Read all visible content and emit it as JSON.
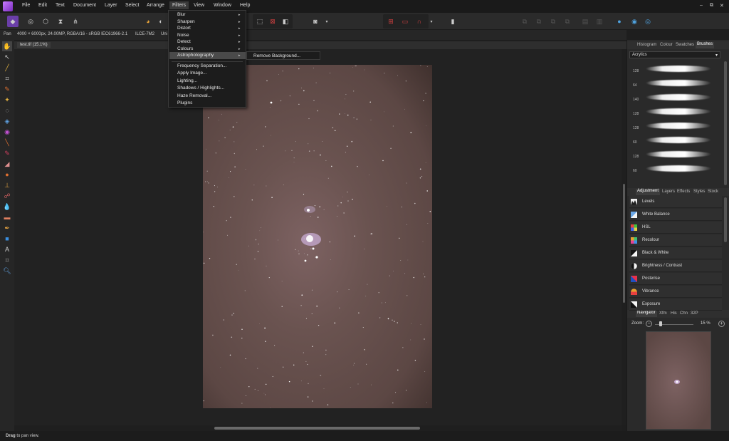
{
  "menubar": {
    "items": [
      "File",
      "Edit",
      "Text",
      "Document",
      "Layer",
      "Select",
      "Arrange",
      "Filters",
      "View",
      "Window",
      "Help"
    ],
    "active": "Filters",
    "window_controls": [
      "–",
      "⧉",
      "✕"
    ]
  },
  "contextbar": {
    "tool": "Pan",
    "info": "4000 × 6000px, 24.00MP, RGBA/16 - sRGB IEC61966-2.1",
    "camera": "ILCE-7M2",
    "units": "Uni"
  },
  "document": {
    "tab": "test.tif (15.1%)"
  },
  "filters_menu": {
    "items": [
      "Blur",
      "Sharpen",
      "Distort",
      "Noise",
      "Detect",
      "Colours",
      "Astrophotography",
      "Frequency Separation...",
      "Apply Image...",
      "Lighting...",
      "Shadows / Highlights...",
      "Haze Removal...",
      "Plugins"
    ],
    "highlighted": "Astrophotography"
  },
  "astro_submenu": {
    "items": [
      "Remove Background..."
    ]
  },
  "brushes_panel": {
    "tabs": [
      "Histogram",
      "Colour",
      "Swatches",
      "Brushes"
    ],
    "active": "Brushes",
    "category": "Acrylics",
    "sizes": [
      "128",
      "64",
      "140",
      "128",
      "128",
      "60",
      "128",
      "60"
    ]
  },
  "adjustment_panel": {
    "tabs": [
      "Adjustment",
      "Layers",
      "Effects",
      "Styles",
      "Stock"
    ],
    "active": "Adjustment",
    "items": [
      "Levels",
      "White Balance",
      "HSL",
      "Recolour",
      "Black & White",
      "Brightness / Contrast",
      "Posterise",
      "Vibrance",
      "Exposure"
    ]
  },
  "navigator_panel": {
    "tabs": [
      "Navigator",
      "Xfm",
      "His",
      "Chn",
      "32P"
    ],
    "active": "Navigator",
    "zoom_label": "Zoom:",
    "zoom_value": "15 %",
    "zoom_fraction": 0.15
  },
  "status": {
    "bold": "Drag",
    "rest": " to pan view."
  },
  "colors": {
    "menubar": "#1a1a1a",
    "panel": "#2a2a2a",
    "canvas": "#222222",
    "photo": "#6a5350",
    "accent": "#7b2cbf"
  }
}
